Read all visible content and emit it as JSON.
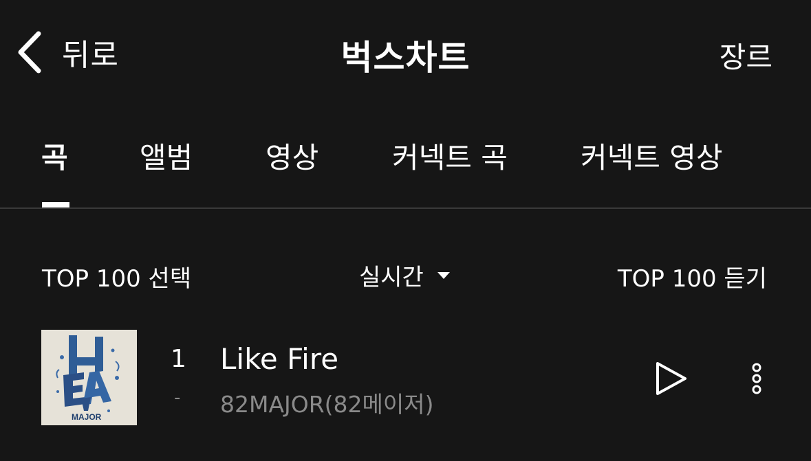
{
  "header": {
    "back_label": "뒤로",
    "title": "벅스차트",
    "genre_label": "장르"
  },
  "tabs": [
    {
      "label": "곡",
      "active": true
    },
    {
      "label": "앨범",
      "active": false
    },
    {
      "label": "영상",
      "active": false
    },
    {
      "label": "커넥트 곡",
      "active": false
    },
    {
      "label": "커넥트 영상",
      "active": false
    }
  ],
  "toolbar": {
    "select_label": "TOP 100 선택",
    "period_label": "실시간",
    "listen_label": "TOP 100 듣기"
  },
  "tracks": [
    {
      "rank": "1",
      "rank_change": "-",
      "title": "Like Fire",
      "artist": "82MAJOR(82메이저)",
      "album_art_text": "MAJOR"
    }
  ],
  "icons": {
    "back": "chevron-left-icon",
    "dropdown": "caret-down-icon",
    "play": "play-icon",
    "more": "more-vertical-icon"
  },
  "colors": {
    "background": "#161616",
    "text_primary": "#ffffff",
    "text_secondary": "#8a8a8a",
    "divider": "#3a3a3a"
  }
}
